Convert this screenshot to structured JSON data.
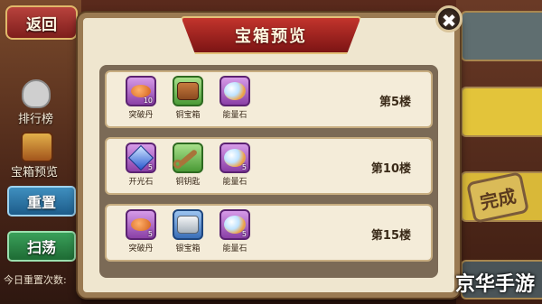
{
  "background": {
    "back_label": "返回",
    "ranking_label": "排行榜",
    "chest_preview_label": "宝箱预览",
    "reset_label": "重置",
    "sweep_label": "扫荡",
    "reset_count_label": "今日重置次数: ",
    "done_stamp": "完成",
    "watermark": "京华手游"
  },
  "modal": {
    "title": "宝箱预览",
    "close_symbol": "✖",
    "floors": [
      {
        "label": "第5楼",
        "items": [
          {
            "name": "突破丹",
            "count": "10",
            "icon": "pill-icon",
            "quality": "purple"
          },
          {
            "name": "铜宝箱",
            "count": "",
            "icon": "chest-icon",
            "quality": "green"
          },
          {
            "name": "能量石",
            "count": "",
            "icon": "stones-icon",
            "quality": "purple"
          }
        ]
      },
      {
        "label": "第10楼",
        "items": [
          {
            "name": "开光石",
            "count": "5",
            "icon": "gem-icon",
            "quality": "purple"
          },
          {
            "name": "铜钥匙",
            "count": "",
            "icon": "key-icon",
            "quality": "green"
          },
          {
            "name": "能量石",
            "count": "5",
            "icon": "stones-icon",
            "quality": "purple"
          }
        ]
      },
      {
        "label": "第15楼",
        "items": [
          {
            "name": "突破丹",
            "count": "5",
            "icon": "pill-icon",
            "quality": "purple"
          },
          {
            "name": "银宝箱",
            "count": "",
            "icon": "silver-chest-icon",
            "quality": "blue"
          },
          {
            "name": "能量石",
            "count": "5",
            "icon": "stones-icon",
            "quality": "purple"
          }
        ]
      }
    ]
  }
}
